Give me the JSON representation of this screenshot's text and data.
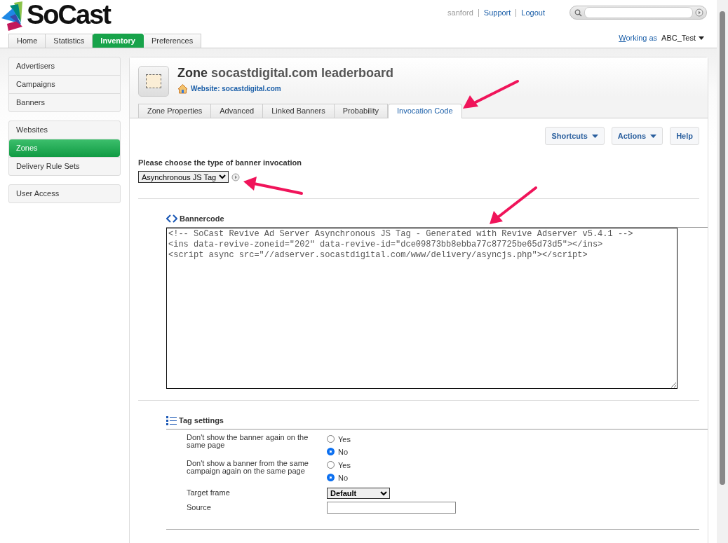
{
  "logo": {
    "text": "SoCast"
  },
  "user_links": [
    {
      "label": "sanford",
      "kind": "user"
    },
    {
      "label": "Support",
      "kind": "link"
    },
    {
      "label": "Logout",
      "kind": "link"
    }
  ],
  "main_tabs": [
    {
      "label": "Home",
      "selected": false
    },
    {
      "label": "Statistics",
      "selected": false
    },
    {
      "label": "Inventory",
      "selected": true
    },
    {
      "label": "Preferences",
      "selected": false
    }
  ],
  "working_as": {
    "label": "Working as",
    "account": "ABC_Test"
  },
  "sidebar": {
    "groups": [
      {
        "items": [
          {
            "label": "Advertisers",
            "selected": false
          },
          {
            "label": "Campaigns",
            "selected": false
          },
          {
            "label": "Banners",
            "selected": false
          }
        ]
      },
      {
        "items": [
          {
            "label": "Websites",
            "selected": false
          },
          {
            "label": "Zones",
            "selected": true
          },
          {
            "label": "Delivery Rule Sets",
            "selected": false
          }
        ]
      },
      {
        "items": [
          {
            "label": "User Access",
            "selected": false
          }
        ]
      }
    ]
  },
  "zone": {
    "prefix": "Zone",
    "name": "socastdigital.com leaderboard",
    "website": "Website: socastdigital.com"
  },
  "zone_tabs": [
    {
      "label": "Zone Properties",
      "selected": false
    },
    {
      "label": "Advanced",
      "selected": false
    },
    {
      "label": "Linked Banners",
      "selected": false
    },
    {
      "label": "Probability",
      "selected": false
    },
    {
      "label": "Invocation Code",
      "selected": true
    }
  ],
  "toolbar": [
    {
      "label": "Shortcuts",
      "dropdown": true
    },
    {
      "label": "Actions",
      "dropdown": true
    },
    {
      "label": "Help",
      "dropdown": false
    }
  ],
  "invocation": {
    "label": "Please choose the type of banner invocation",
    "value": "Asynchronous JS Tag"
  },
  "bannercode": {
    "heading": "Bannercode",
    "code": "<!-- SoCast Revive Ad Server Asynchronous JS Tag - Generated with Revive Adserver v5.4.1 -->\n<ins data-revive-zoneid=\"202\" data-revive-id=\"dce09873bb8ebba77c87725be65d73d5\"></ins>\n<script async src=\"//adserver.socastdigital.com/www/delivery/asyncjs.php\"></script>"
  },
  "tag_settings": {
    "heading": "Tag settings",
    "rows": [
      {
        "kind": "radio",
        "label": "Don't show the banner again on the same page",
        "options": [
          {
            "label": "Yes",
            "selected": false
          },
          {
            "label": "No",
            "selected": true
          }
        ]
      },
      {
        "kind": "radio",
        "label": "Don't show a banner from the same campaign again on the same page",
        "options": [
          {
            "label": "Yes",
            "selected": false
          },
          {
            "label": "No",
            "selected": true
          }
        ]
      },
      {
        "kind": "select",
        "label": "Target frame",
        "value": "Default"
      },
      {
        "kind": "text",
        "label": "Source"
      }
    ]
  }
}
